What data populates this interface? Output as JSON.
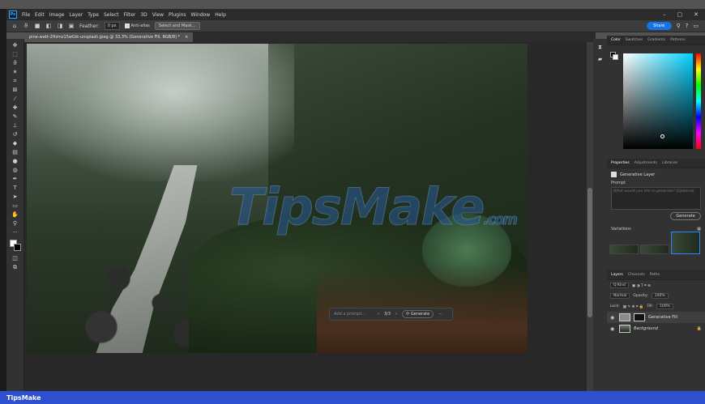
{
  "app": {
    "logo": "Ps"
  },
  "menu": [
    "File",
    "Edit",
    "Image",
    "Layer",
    "Type",
    "Select",
    "Filter",
    "3D",
    "View",
    "Plugins",
    "Window",
    "Help"
  ],
  "window_controls": {
    "minimize": "–",
    "maximize": "▢",
    "close": "✕"
  },
  "options_bar": {
    "feather_label": "Feather:",
    "feather_value": "0 px",
    "antialias_label": "Anti-alias",
    "select_mask_label": "Select and Mask...",
    "share_label": "Share"
  },
  "document": {
    "tab_title": "pine-watt-2Hzmz15wGik-unsplash.jpeg @ 33,3% (Generative Fill, RGB/8) *",
    "tab_close": "×"
  },
  "watermark": {
    "main": "TipsMake",
    "suffix": ".com"
  },
  "gen_bar": {
    "placeholder": "Add a prompt...",
    "counter": "3/3",
    "prev": "‹",
    "next": "›",
    "generate_label": "Generate",
    "more": "···"
  },
  "color_panel": {
    "tabs": [
      "Color",
      "Swatches",
      "Gradients",
      "Patterns"
    ],
    "active": "Color"
  },
  "properties_panel": {
    "tabs": [
      "Properties",
      "Adjustments",
      "Libraries"
    ],
    "layer_type": "Generative Layer",
    "prompt_label": "Prompt",
    "prompt_placeholder": "What would you like to generate? (Optional)",
    "generate_label": "Generate",
    "variations_label": "Variations"
  },
  "layers_panel": {
    "tabs": [
      "Layers",
      "Channels",
      "Paths"
    ],
    "kind_label": "Q Kind",
    "blend_mode": "Normal",
    "opacity_label": "Opacity:",
    "opacity_value": "100%",
    "lock_label": "Lock:",
    "fill_label": "Fill:",
    "fill_value": "100%",
    "layers": [
      {
        "name": "Generative Fill",
        "active": true
      },
      {
        "name": "Background",
        "active": false
      }
    ]
  },
  "footer": {
    "brand": "TipsMake"
  },
  "colors": {
    "accent": "#1473e6",
    "footer": "#2f4fd1",
    "panel": "#323232",
    "bar": "#2b2b2b"
  }
}
